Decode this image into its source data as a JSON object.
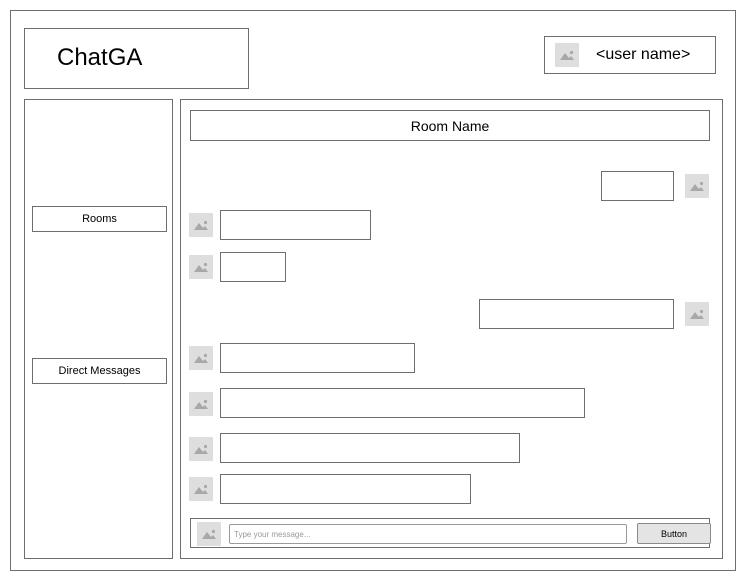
{
  "header": {
    "app_title": "ChatGA",
    "user_name": "<user name>",
    "user_avatar_icon": "image-placeholder-icon"
  },
  "sidebar": {
    "items": [
      {
        "label": "Rooms"
      },
      {
        "label": "Direct Messages"
      }
    ]
  },
  "room": {
    "title": "Room Name",
    "messages": [
      {
        "sender": "self",
        "text": "",
        "avatar_icon": "image-placeholder-icon"
      },
      {
        "sender": "other",
        "text": "",
        "avatar_icon": "image-placeholder-icon"
      },
      {
        "sender": "other",
        "text": "",
        "avatar_icon": "image-placeholder-icon"
      },
      {
        "sender": "self",
        "text": "",
        "avatar_icon": "image-placeholder-icon"
      },
      {
        "sender": "other",
        "text": "",
        "avatar_icon": "image-placeholder-icon"
      },
      {
        "sender": "other",
        "text": "",
        "avatar_icon": "image-placeholder-icon"
      },
      {
        "sender": "other",
        "text": "",
        "avatar_icon": "image-placeholder-icon"
      },
      {
        "sender": "other",
        "text": "",
        "avatar_icon": "image-placeholder-icon"
      }
    ]
  },
  "composer": {
    "placeholder": "Type your message...",
    "value": "",
    "send_label": "Button",
    "avatar_icon": "image-placeholder-icon"
  },
  "colors": {
    "border": "#6e6e6e",
    "placeholder_bg": "#dedede",
    "button_bg": "#e4e4e4"
  }
}
